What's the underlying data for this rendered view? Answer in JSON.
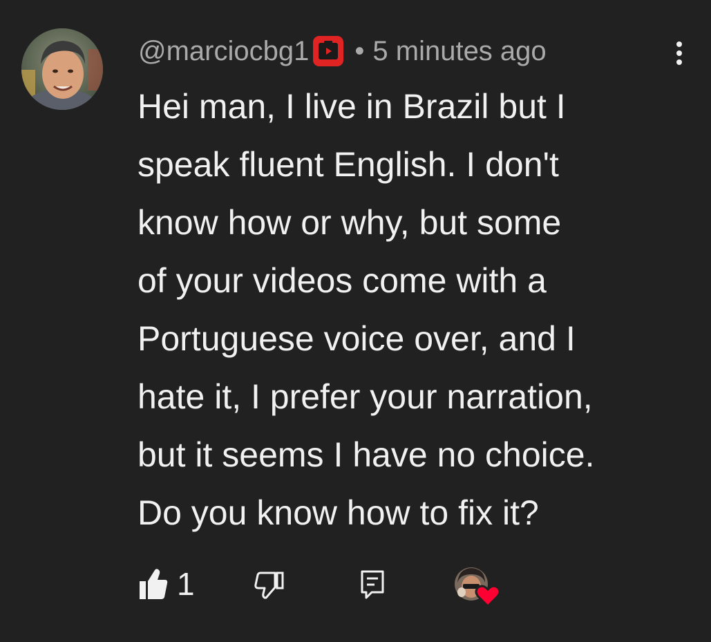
{
  "comment": {
    "author": "@marciocbg1",
    "separator": "•",
    "timestamp": "5 minutes ago",
    "badge_icon": "youtube-member-badge-icon",
    "badge_color": "#e02424",
    "lines": [
      "Hei man, I live in Brazil but I",
      "speak fluent English. I don't",
      "know how or why, but some",
      "of your videos come with a",
      "Portuguese voice over, and I",
      "hate it, I prefer your narration,",
      "but it seems I have no choice.",
      "Do you know how to fix it?"
    ]
  },
  "actions": {
    "like_count": "1",
    "like_icon": "thumbs-up-icon",
    "dislike_icon": "thumbs-down-icon",
    "reply_icon": "reply-icon",
    "creator_heart_icon": "creator-heart-icon",
    "heart_color": "#ff0033"
  },
  "colors": {
    "background": "#212121",
    "text_primary": "#f1f1f1",
    "text_secondary": "#aaaaaa"
  }
}
